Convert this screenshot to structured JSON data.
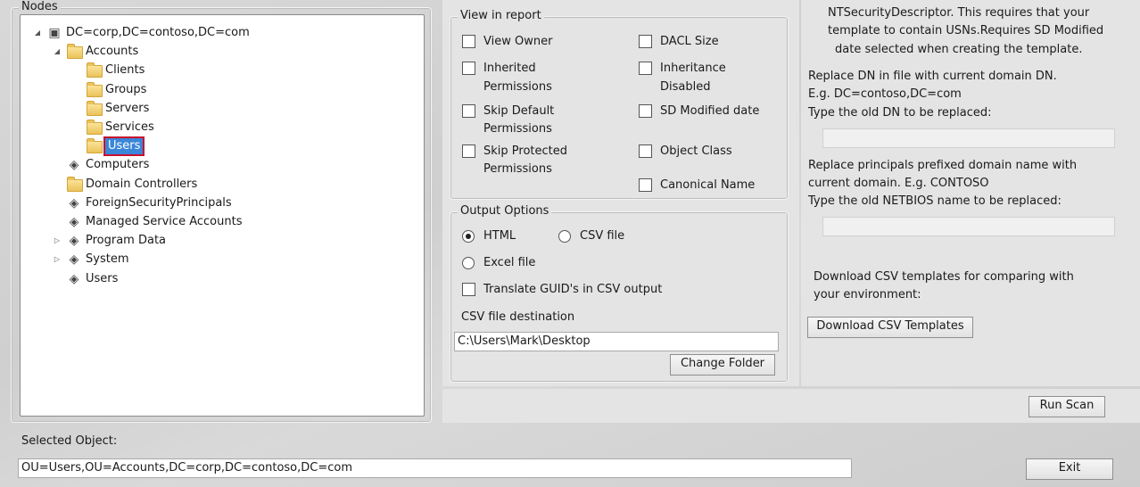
{
  "nodes": {
    "legend": "Nodes",
    "tree": [
      {
        "label": "DC=corp,DC=contoso,DC=com",
        "icon": "domain-icon",
        "level": 0,
        "expander": "expanded"
      },
      {
        "label": "Accounts",
        "icon": "folder-icon",
        "level": 1,
        "expander": "expanded"
      },
      {
        "label": "Clients",
        "icon": "folder-icon",
        "level": 2,
        "expander": ""
      },
      {
        "label": "Groups",
        "icon": "folder-icon",
        "level": 2,
        "expander": ""
      },
      {
        "label": "Servers",
        "icon": "folder-icon",
        "level": 2,
        "expander": ""
      },
      {
        "label": "Services",
        "icon": "folder-icon",
        "level": 2,
        "expander": ""
      },
      {
        "label": "Users",
        "icon": "folder-icon",
        "level": 2,
        "expander": "",
        "selected": true
      },
      {
        "label": "Computers",
        "icon": "container-icon",
        "level": 1,
        "expander": ""
      },
      {
        "label": "Domain Controllers",
        "icon": "folder-icon",
        "level": 1,
        "expander": ""
      },
      {
        "label": "ForeignSecurityPrincipals",
        "icon": "container-icon",
        "level": 1,
        "expander": ""
      },
      {
        "label": "Managed Service Accounts",
        "icon": "container-icon",
        "level": 1,
        "expander": ""
      },
      {
        "label": "Program Data",
        "icon": "container-icon",
        "level": 1,
        "expander": "collapsed"
      },
      {
        "label": "System",
        "icon": "container-icon",
        "level": 1,
        "expander": "collapsed"
      },
      {
        "label": "Users",
        "icon": "container-icon",
        "level": 1,
        "expander": ""
      }
    ]
  },
  "view_in_report": {
    "legend": "View in report",
    "view_owner": "View Owner",
    "dacl_size": "DACL Size",
    "inherited_permissions_1": "Inherited",
    "inherited_permissions_2": "Permissions",
    "inheritance_disabled_1": "Inheritance",
    "inheritance_disabled_2": "Disabled",
    "skip_default_1": "Skip Default",
    "skip_default_2": "Permissions",
    "sd_modified_date": "SD Modified date",
    "skip_protected_1": "Skip Protected",
    "skip_protected_2": "Permissions",
    "object_class": "Object Class",
    "canonical_name": "Canonical Name"
  },
  "output_options": {
    "legend": "Output Options",
    "html": "HTML",
    "csv_file": "CSV file",
    "excel_file": "Excel file",
    "translate_guid": "Translate GUID's in CSV output",
    "csv_destination_label": "CSV file destination",
    "csv_destination_value": "C:\\Users\\Mark\\Desktop",
    "change_folder": "Change Folder"
  },
  "right_panel": {
    "desc_line1": "NTSecurityDescriptor. This requires that your",
    "desc_line2": "template to contain USNs.Requires SD Modified",
    "desc_line3": "date selected when creating the template.",
    "replace_dn_line1": "Replace DN in file with current domain DN.",
    "replace_dn_line2": "E.g. DC=contoso,DC=com",
    "old_dn_label": "Type the old DN to be replaced:",
    "old_dn_value": "",
    "replace_principals_line1": "Replace principals prefixed domain name with",
    "replace_principals_line2": "current domain. E.g. CONTOSO",
    "old_netbios_label": "Type the old NETBIOS name to be replaced:",
    "old_netbios_value": "",
    "download_text_line1": "Download CSV templates for comparing with",
    "download_text_line2": "your environment:",
    "download_button": "Download CSV Templates"
  },
  "run_scan": "Run Scan",
  "selected_object_label": "Selected Object:",
  "selected_object_value": "OU=Users,OU=Accounts,DC=corp,DC=contoso,DC=com",
  "exit": "Exit"
}
